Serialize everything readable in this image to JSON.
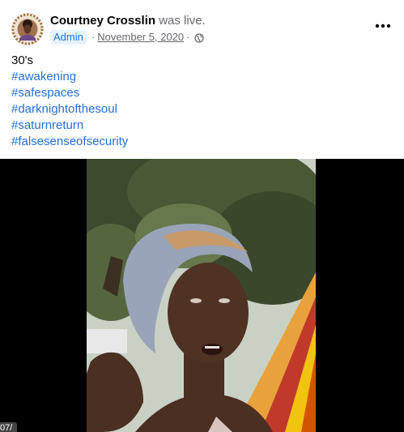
{
  "post": {
    "author": "Courtney Crosslin",
    "action": "was live.",
    "badge": "Admin",
    "date": "November 5, 2020",
    "privacy_icon": "globe-icon",
    "more_icon": "more-options-icon",
    "lines": [
      "30's"
    ],
    "hashtags": [
      "#awakening",
      "#safespaces",
      "#darknightofthesoul",
      "#saturnreturn",
      "#falsesenseofsecurity"
    ]
  },
  "video": {
    "timestamp": "07/"
  },
  "colors": {
    "link": "#216fdb",
    "badge_bg": "#e7f3ff",
    "badge_text": "#1877f2",
    "secondary_text": "#65676b",
    "primary_text": "#050505",
    "video_bg": "#000000"
  }
}
